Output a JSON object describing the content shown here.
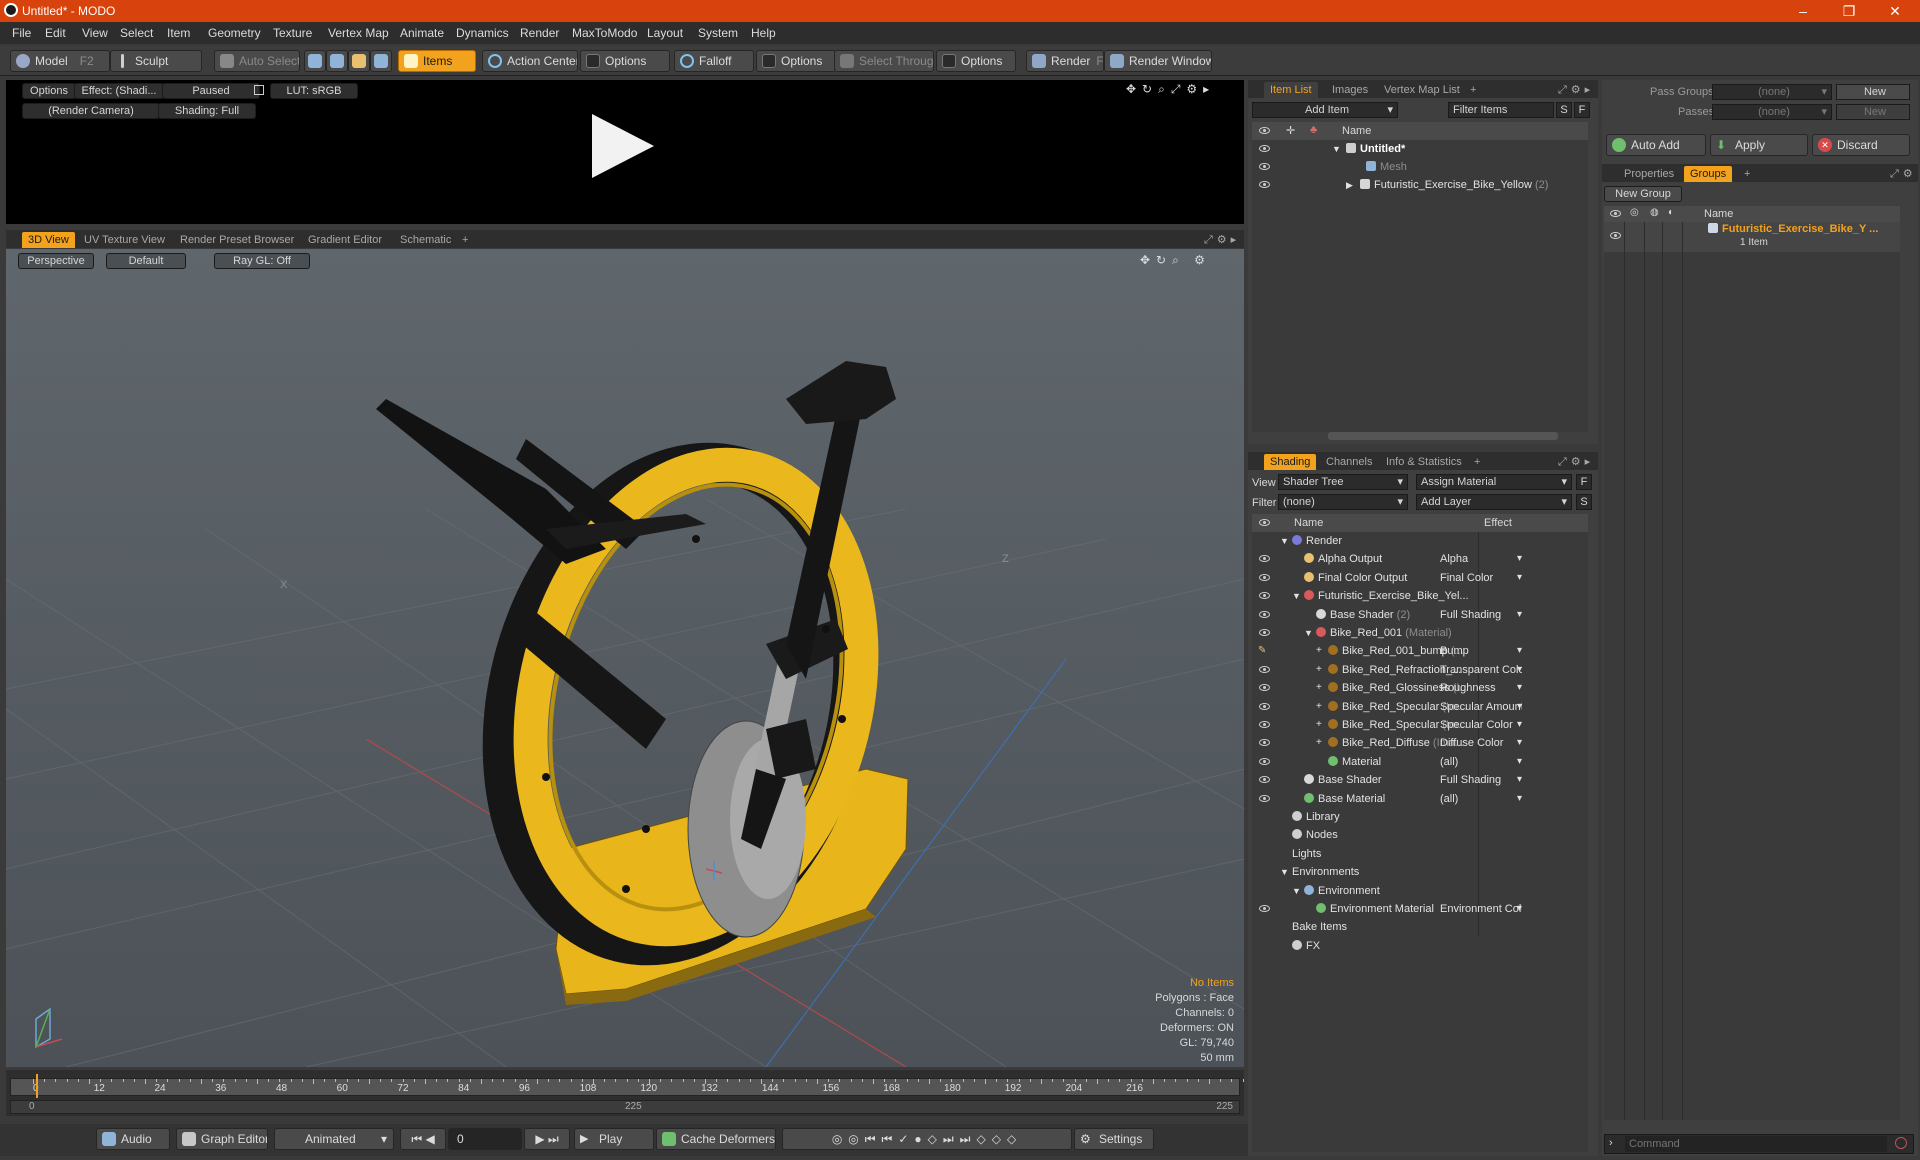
{
  "window": {
    "title": "Untitled* - MODO"
  },
  "menu": [
    "File",
    "Edit",
    "View",
    "Select",
    "Item",
    "Geometry",
    "Texture",
    "Vertex Map",
    "Animate",
    "Dynamics",
    "Render",
    "MaxToModo",
    "Layout",
    "System",
    "Help"
  ],
  "toolbar": {
    "model": "Model",
    "model_key": "F2",
    "sculpt": "Sculpt",
    "auto_select": "Auto Select",
    "items": "Items",
    "action_center": "Action Center",
    "options1": "Options",
    "falloff": "Falloff",
    "options2": "Options",
    "select_through": "Select Through",
    "options3": "Options",
    "render": "Render",
    "render_key": "F9",
    "render_window": "Render Window"
  },
  "preview": {
    "options": "Options",
    "effect": "Effect: (Shadi...",
    "paused": "Paused",
    "lut": "LUT: sRGB",
    "camera": "(Render Camera)",
    "shading": "Shading: Full"
  },
  "viewport_tabs": [
    "3D View",
    "UV Texture View",
    "Render Preset Browser",
    "Gradient Editor",
    "Schematic"
  ],
  "viewport": {
    "perspective": "Perspective",
    "default": "Default",
    "raygl": "Ray GL: Off",
    "axis_x": "X",
    "axis_z": "Z",
    "stats": {
      "no_items": "No Items",
      "polygons": "Polygons : Face",
      "channels": "Channels: 0",
      "deformers": "Deformers: ON",
      "gl": "GL: 79,740",
      "mm": "50 mm"
    }
  },
  "timeline": {
    "ticks": [
      "0",
      "12",
      "24",
      "36",
      "48",
      "60",
      "72",
      "84",
      "96",
      "108",
      "120",
      "132",
      "144",
      "156",
      "168",
      "180",
      "192",
      "204",
      "216"
    ],
    "start": "0",
    "mid": "225",
    "end": "225"
  },
  "bottombar": {
    "audio": "Audio",
    "graph_editor": "Graph Editor",
    "animated": "Animated",
    "frame": "0",
    "play": "Play",
    "cache_deformers": "Cache Deformers",
    "settings": "Settings"
  },
  "itemlist": {
    "tabs": [
      "Item List",
      "Images",
      "Vertex Map List"
    ],
    "add_item": "Add Item",
    "filter_items": "Filter Items",
    "s": "S",
    "f": "F",
    "name_header": "Name",
    "rows": [
      {
        "label": "Untitled*",
        "suffix": ""
      },
      {
        "label": "Mesh",
        "suffix": ""
      },
      {
        "label": "Futuristic_Exercise_Bike_Yellow",
        "suffix": "(2)"
      }
    ]
  },
  "shading": {
    "tabs": [
      "Shading",
      "Channels",
      "Info & Statistics"
    ],
    "view_label": "View",
    "view_value": "Shader Tree",
    "assign_material": "Assign Material",
    "f": "F",
    "filter_label": "Filter",
    "filter_value": "(none)",
    "add_layer": "Add Layer",
    "s": "S",
    "name_header": "Name",
    "effect_header": "Effect",
    "rows": [
      {
        "label": "Render",
        "note": "",
        "effect": ""
      },
      {
        "label": "Alpha Output",
        "note": "",
        "effect": "Alpha"
      },
      {
        "label": "Final Color Output",
        "note": "",
        "effect": "Final Color"
      },
      {
        "label": "Futuristic_Exercise_Bike_Yel...",
        "note": "",
        "effect": ""
      },
      {
        "label": "Base Shader",
        "note": "(2)",
        "effect": "Full Shading"
      },
      {
        "label": "Bike_Red_001",
        "note": "(Material)",
        "effect": ""
      },
      {
        "label": "Bike_Red_001_bump",
        "note": "(...",
        "effect": "Bump"
      },
      {
        "label": "Bike_Red_Refraction_...",
        "note": "",
        "effect": "Transparent Color"
      },
      {
        "label": "Bike_Red_Glossiness",
        "note": "(I...",
        "effect": "Roughness"
      },
      {
        "label": "Bike_Red_Specular",
        "note": "(Im...",
        "effect": "Specular Amount"
      },
      {
        "label": "Bike_Red_Specular",
        "note": "(Im...",
        "effect": "Specular Color"
      },
      {
        "label": "Bike_Red_Diffuse",
        "note": "(Ima...",
        "effect": "Diffuse Color"
      },
      {
        "label": "Material",
        "note": "",
        "effect": "(all)"
      },
      {
        "label": "Base Shader",
        "note": "",
        "effect": "Full Shading"
      },
      {
        "label": "Base Material",
        "note": "",
        "effect": "(all)"
      },
      {
        "label": "Library",
        "note": "",
        "effect": ""
      },
      {
        "label": "Nodes",
        "note": "",
        "effect": ""
      },
      {
        "label": "Lights",
        "note": "",
        "effect": ""
      },
      {
        "label": "Environments",
        "note": "",
        "effect": ""
      },
      {
        "label": "Environment",
        "note": "",
        "effect": ""
      },
      {
        "label": "Environment Material",
        "note": "",
        "effect": "Environment Color"
      },
      {
        "label": "Bake Items",
        "note": "",
        "effect": ""
      },
      {
        "label": "FX",
        "note": "",
        "effect": ""
      }
    ]
  },
  "groups": {
    "pass_groups_label": "Pass Groups",
    "pass_groups_value": "(none)",
    "new1": "New",
    "passes_label": "Passes",
    "passes_value": "(none)",
    "new2": "New",
    "auto_add": "Auto Add",
    "apply": "Apply",
    "discard": "Discard",
    "tabs": [
      "Properties",
      "Groups"
    ],
    "new_group": "New Group",
    "name_header": "Name",
    "group_name": "Futuristic_Exercise_Bike_Y ...",
    "group_count": "1 Item",
    "command_placeholder": "Command"
  },
  "colors": {
    "accent": "#f2a21c",
    "titlebar": "#d8420c",
    "bike": "#f0b51a"
  }
}
